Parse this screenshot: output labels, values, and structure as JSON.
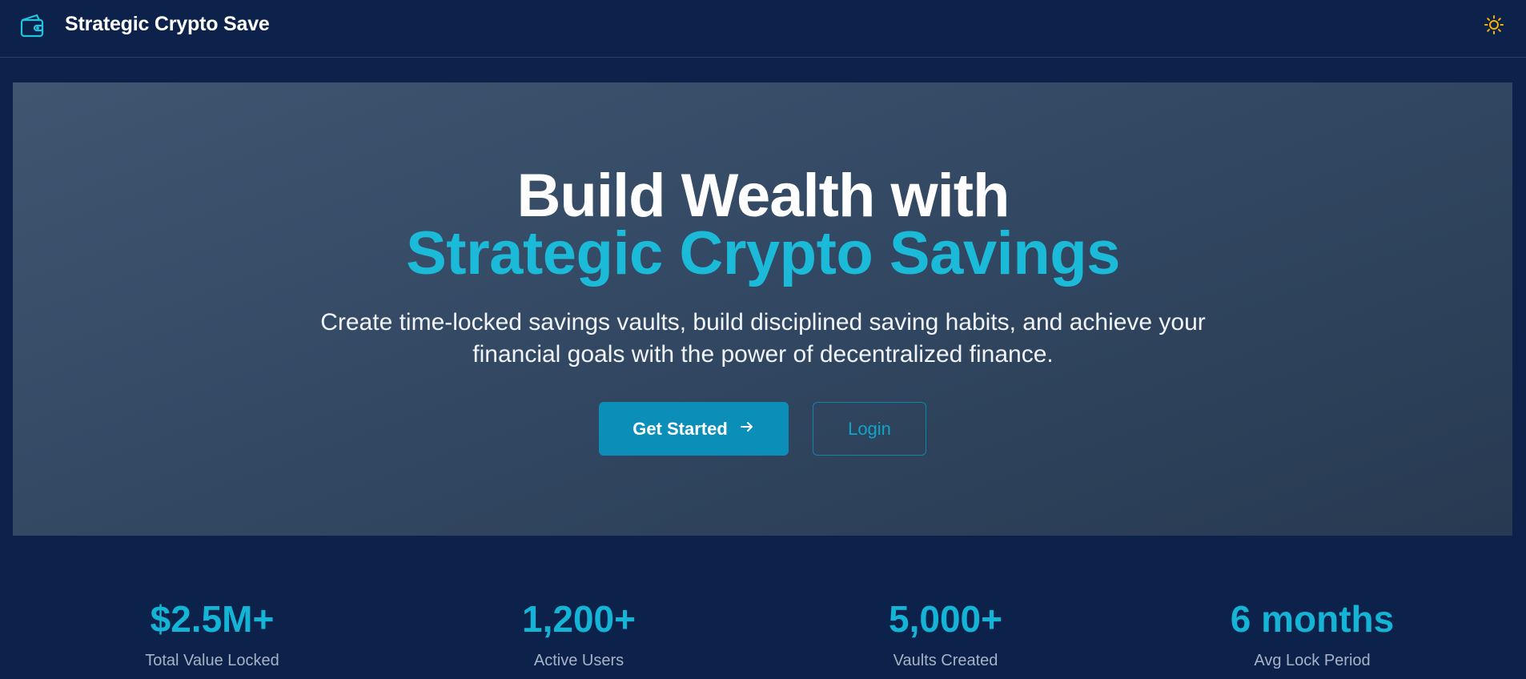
{
  "header": {
    "app_title": "Strategic Crypto Save",
    "logo_icon": "wallet-icon",
    "theme_icon": "sun-icon"
  },
  "hero": {
    "headline_line1": "Build Wealth with",
    "headline_line2": "Strategic Crypto Savings",
    "subtitle": "Create time-locked savings vaults, build disciplined saving habits, and achieve your financial goals with the power of decentralized finance.",
    "primary_button": "Get Started",
    "primary_button_icon": "arrow-right-icon",
    "secondary_button": "Login"
  },
  "stats": [
    {
      "value": "$2.5M+",
      "label": "Total Value Locked"
    },
    {
      "value": "1,200+",
      "label": "Active Users"
    },
    {
      "value": "5,000+",
      "label": "Vaults Created"
    },
    {
      "value": "6 months",
      "label": "Avg Lock Period"
    }
  ],
  "colors": {
    "background": "#0c224a",
    "accent": "#14b4d6",
    "primary_button": "#0b8fb8",
    "theme_icon": "#f5b400"
  }
}
